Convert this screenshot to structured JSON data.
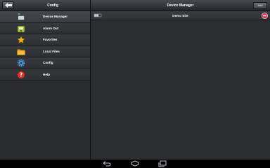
{
  "left_pane": {
    "title": "Config",
    "back_icon": "back-arrow-icon"
  },
  "menu": {
    "items": [
      {
        "label": "Device Manager",
        "icon": "device-manager-icon",
        "selected": true
      },
      {
        "label": "Alarm Out",
        "icon": "alarm-out-icon",
        "selected": false
      },
      {
        "label": "Favorites",
        "icon": "star-icon",
        "selected": false
      },
      {
        "label": "Local Files",
        "icon": "folder-icon",
        "selected": false
      },
      {
        "label": "Config",
        "icon": "gear-icon",
        "selected": false
      },
      {
        "label": "Help",
        "icon": "help-icon",
        "selected": false
      }
    ]
  },
  "right_pane": {
    "title": "Device Manager",
    "add_label": "Add",
    "sites": [
      {
        "name": "Demo Site",
        "icon": "site-device-icon",
        "action_icon": "remove-icon"
      }
    ]
  },
  "nav": {
    "back_icon": "nav-back-icon",
    "home_icon": "nav-home-icon",
    "recents_icon": "nav-recents-icon"
  },
  "colors": {
    "panel_bg": "#2b2d31",
    "header_bg": "#3a3c40",
    "remove_red": "#e0305a",
    "star_yellow": "#f5b400"
  }
}
